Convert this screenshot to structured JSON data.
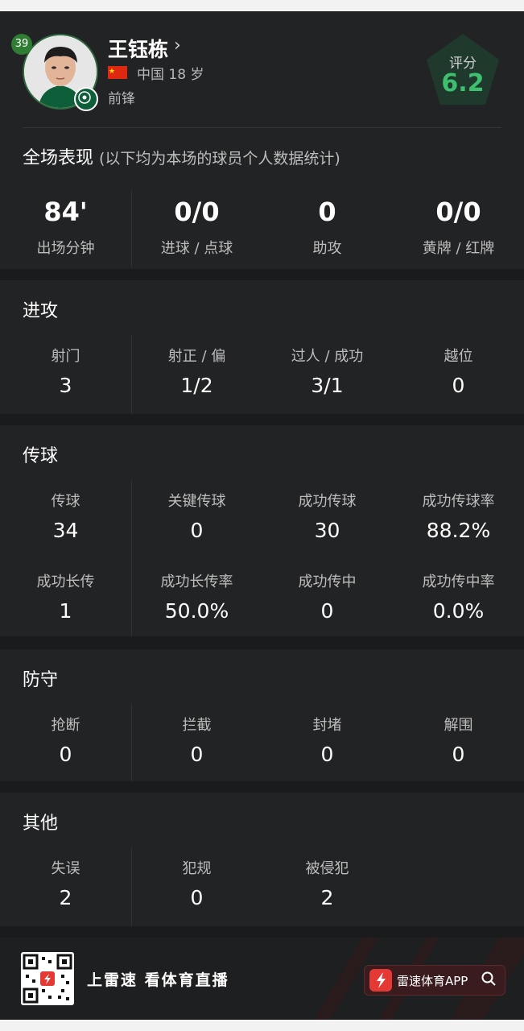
{
  "player": {
    "number": "39",
    "name": "王钰栋",
    "chevron": "›",
    "country": "中国",
    "age": "18 岁",
    "position": "前锋",
    "rating_label": "评分",
    "rating": "6.2"
  },
  "full_match": {
    "title": "全场表现",
    "subtitle": "(以下均为本场的球员个人数据统计)",
    "stats": [
      {
        "value": "84'",
        "label": "出场分钟"
      },
      {
        "value": "0/0",
        "label": "进球 / 点球"
      },
      {
        "value": "0",
        "label": "助攻"
      },
      {
        "value": "0/0",
        "label": "黄牌 / 红牌"
      }
    ]
  },
  "attack": {
    "title": "进攻",
    "stats": [
      {
        "label": "射门",
        "value": "3"
      },
      {
        "label": "射正 / 偏",
        "value": "1/2"
      },
      {
        "label": "过人 / 成功",
        "value": "3/1"
      },
      {
        "label": "越位",
        "value": "0"
      }
    ]
  },
  "passing": {
    "title": "传球",
    "stats": [
      {
        "label": "传球",
        "value": "34"
      },
      {
        "label": "关键传球",
        "value": "0"
      },
      {
        "label": "成功传球",
        "value": "30"
      },
      {
        "label": "成功传球率",
        "value": "88.2%"
      },
      {
        "label": "成功长传",
        "value": "1"
      },
      {
        "label": "成功长传率",
        "value": "50.0%"
      },
      {
        "label": "成功传中",
        "value": "0"
      },
      {
        "label": "成功传中率",
        "value": "0.0%"
      }
    ]
  },
  "defense": {
    "title": "防守",
    "stats": [
      {
        "label": "抢断",
        "value": "0"
      },
      {
        "label": "拦截",
        "value": "0"
      },
      {
        "label": "封堵",
        "value": "0"
      },
      {
        "label": "解围",
        "value": "0"
      }
    ]
  },
  "others": {
    "title": "其他",
    "stats": [
      {
        "label": "失误",
        "value": "2"
      },
      {
        "label": "犯规",
        "value": "0"
      },
      {
        "label": "被侵犯",
        "value": "2"
      }
    ]
  },
  "footer": {
    "slogan": "上雷速 看体育直播",
    "app_name": "雷速体育APP"
  },
  "colors": {
    "background": "#222325",
    "rating_green": "#3ec16f",
    "badge_green": "#2e7d32",
    "brand_red": "#e53935"
  },
  "icons": [
    "chevron-right-icon",
    "china-flag-icon",
    "club-badge-icon",
    "qr-code-icon",
    "app-logo-icon",
    "search-icon"
  ]
}
